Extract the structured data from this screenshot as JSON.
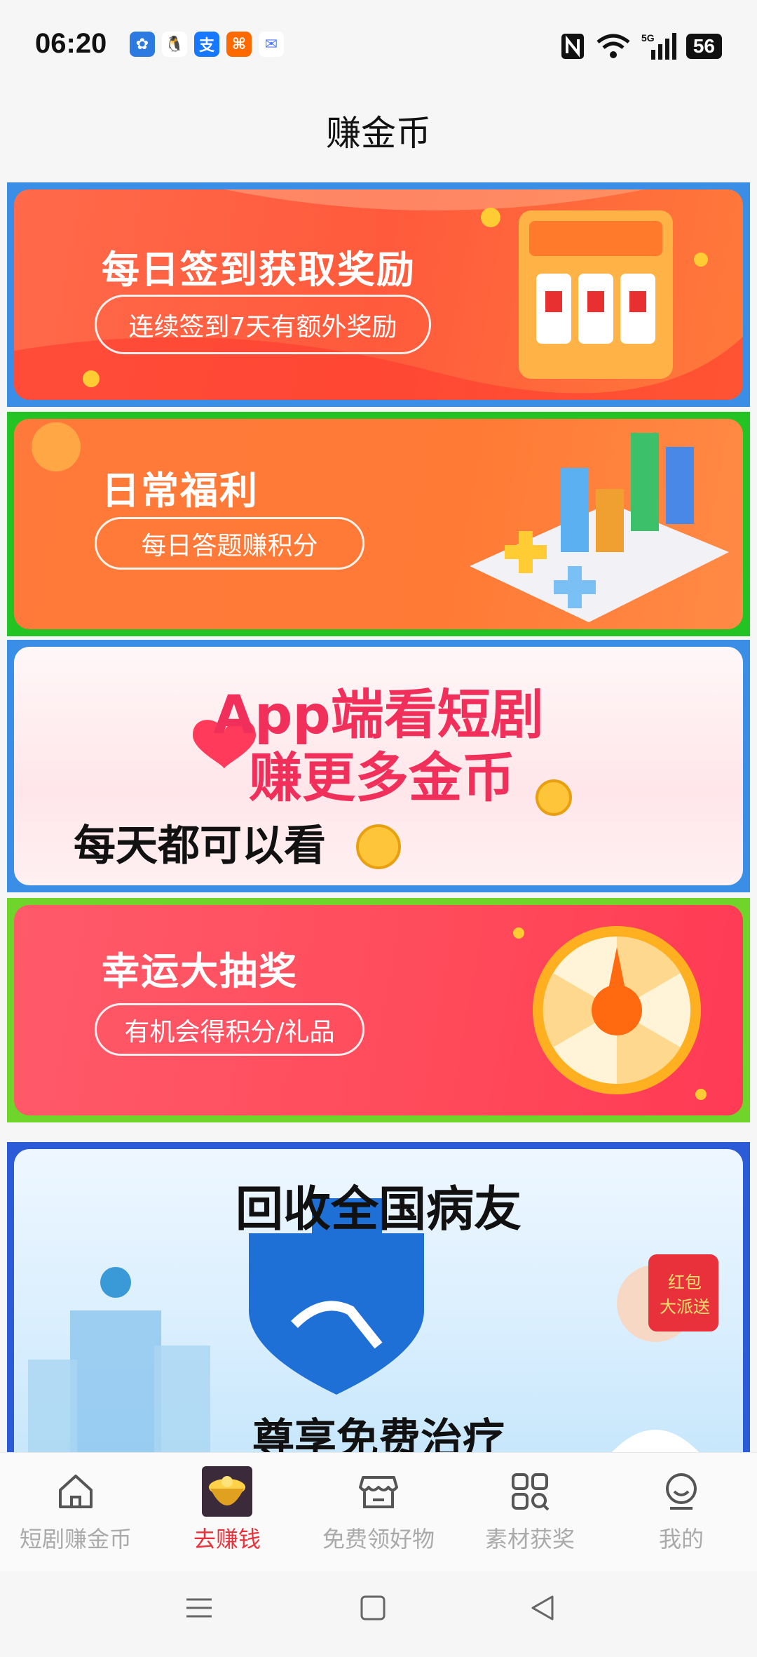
{
  "status": {
    "time": "06:20",
    "battery": "56",
    "network": "5G",
    "notif_icons": [
      "pinwheel-app-icon",
      "qq-icon",
      "alipay-icon",
      "taobao-icon",
      "message-icon"
    ],
    "notif_glyphs": [
      "✿",
      "🐧",
      "支",
      "⌘",
      "✉"
    ],
    "notif_colors": [
      "#2a7ae2",
      "#ffffff",
      "#1677ff",
      "#ff6a00",
      "#4f7cf7"
    ]
  },
  "header": {
    "title": "赚金币"
  },
  "banners": [
    {
      "name": "daily-checkin-banner",
      "title": "每日签到获取奖励",
      "subtitle": "连续签到7天有额外奖励",
      "frame": "#3a8ee6"
    },
    {
      "name": "daily-welfare-banner",
      "title": "日常福利",
      "subtitle": "每日答题赚积分",
      "frame": "#22c322"
    },
    {
      "name": "short-drama-banner",
      "line1": "App端看短剧",
      "line2": "赚更多金币",
      "line3": "每天都可以看",
      "frame": "#3a8ee6"
    },
    {
      "name": "lucky-draw-banner",
      "title": "幸运大抽奖",
      "subtitle": "有机会得积分/礼品",
      "frame": "#6fd52a"
    },
    {
      "name": "patient-recycle-banner",
      "title": "回收全国病友",
      "subtitle": "尊享免费治疗",
      "badge": "红包\n大派送",
      "frame": "#2b5bd6"
    }
  ],
  "tabs": [
    {
      "label": "短剧赚金币",
      "icon": "home-icon",
      "active": false
    },
    {
      "label": "去赚钱",
      "icon": "treasure-pot-icon",
      "active": true
    },
    {
      "label": "免费领好物",
      "icon": "store-icon",
      "active": false
    },
    {
      "label": "素材获奖",
      "icon": "grid-search-icon",
      "active": false
    },
    {
      "label": "我的",
      "icon": "profile-icon",
      "active": false
    }
  ]
}
